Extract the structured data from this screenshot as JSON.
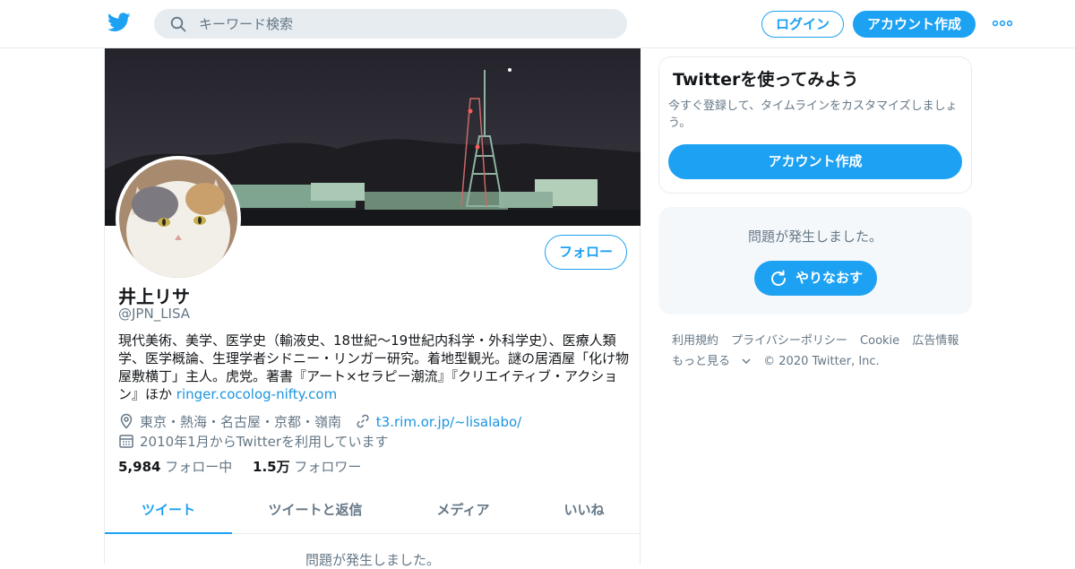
{
  "header": {
    "search_placeholder": "キーワード検索",
    "login_label": "ログイン",
    "signup_label": "アカウント作成"
  },
  "profile": {
    "follow_label": "フォロー",
    "display_name": "井上リサ",
    "handle": "@JPN_LISA",
    "bio": "現代美術、美学、医学史（輸液史、18世紀～19世紀内科学・外科学史）、医療人類学、医学概論、生理学者シドニー・リンガー研究。着地型観光。謎の居酒屋「化け物屋敷横丁」主人。虎党。著書『アート×セラピー潮流』『クリエイティブ・アクション』ほか",
    "bio_link": "ringer.cocolog-nifty.com",
    "location": "東京・熱海・名古屋・京都・嶺南",
    "website": "t3.rim.or.jp/~lisalabo/",
    "joined": "2010年1月からTwitterを利用しています",
    "following_count": "5,984",
    "following_label": "フォロー中",
    "followers_count": "1.5万",
    "followers_label": "フォロワー"
  },
  "tabs": [
    {
      "label": "ツイート",
      "active": true
    },
    {
      "label": "ツイートと返信",
      "active": false
    },
    {
      "label": "メディア",
      "active": false
    },
    {
      "label": "いいね",
      "active": false
    }
  ],
  "timeline": {
    "error_text": "問題が発生しました。"
  },
  "signup_card": {
    "title": "Twitterを使ってみよう",
    "description": "今すぐ登録して、タイムラインをカスタマイズしましょう。",
    "button_label": "アカウント作成"
  },
  "error_panel": {
    "message": "問題が発生しました。",
    "retry_label": "やりなおす"
  },
  "footer": {
    "links": [
      "利用規約",
      "プライバシーポリシー",
      "Cookie",
      "広告情報"
    ],
    "more_label": "もっと見る",
    "copyright": "© 2020 Twitter, Inc."
  },
  "colors": {
    "accent": "#1da1f2",
    "link": "#1b95e0",
    "muted": "#657786",
    "border": "#e6ecf0"
  },
  "icons": [
    "twitter-logo-icon",
    "search-icon",
    "more-dots-icon",
    "location-pin-icon",
    "link-icon",
    "calendar-icon",
    "retry-icon",
    "chevron-down-icon"
  ]
}
